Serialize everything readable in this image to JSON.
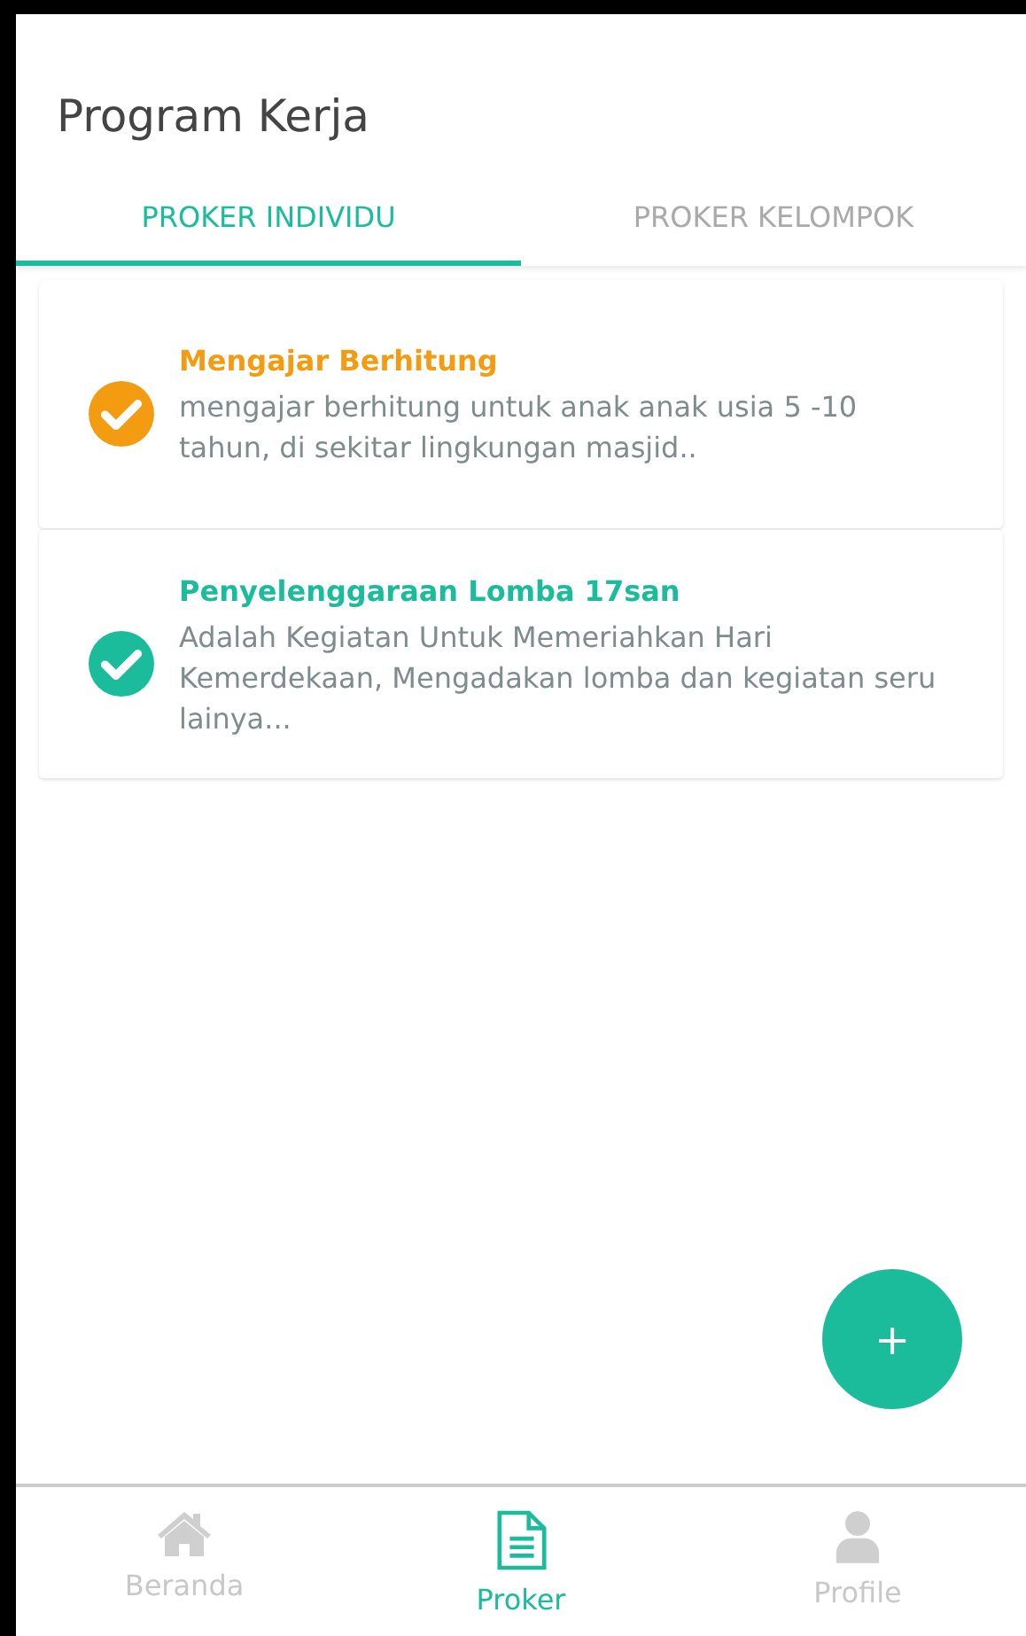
{
  "app_bar": {
    "title": "Program Kerja"
  },
  "tabs": [
    {
      "label": "PROKER INDIVIDU",
      "selected": true
    },
    {
      "label": "PROKER KELOMPOK",
      "selected": false
    }
  ],
  "items": [
    {
      "title": "Mengajar Berhitung",
      "description": "mengajar berhitung untuk anak anak usia 5 -10 tahun, di sekitar lingkungan masjid..",
      "color": "#f39c12"
    },
    {
      "title": "Penyelenggaraan Lomba 17san",
      "description": "Adalah Kegiatan Untuk Memeriahkan Hari Kemerdekaan, Mengadakan lomba dan kegiatan seru lainya...",
      "color": "#1abc9c"
    }
  ],
  "fab": {
    "label": "+"
  },
  "bottom_nav": [
    {
      "kind": "home",
      "label": "Beranda",
      "selected": false
    },
    {
      "kind": "document",
      "label": "Proker",
      "selected": true
    },
    {
      "kind": "person",
      "label": "Profile",
      "selected": false
    }
  ]
}
